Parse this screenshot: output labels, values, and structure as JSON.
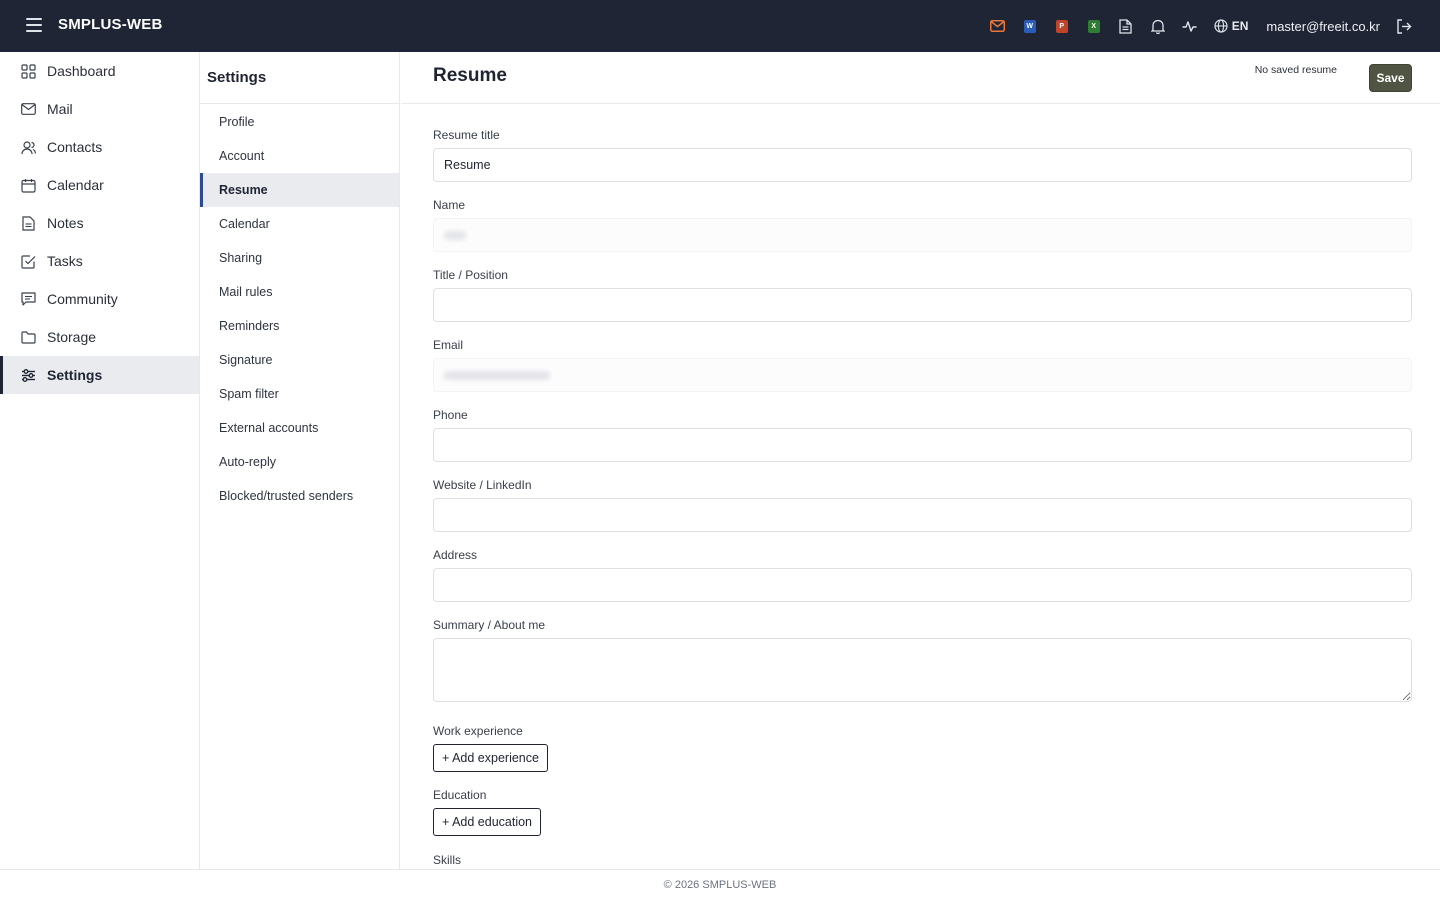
{
  "app": {
    "title": "SMPLUS-WEB"
  },
  "topbar": {
    "icons": [
      "mail-icon",
      "word-icon",
      "powerpoint-icon",
      "excel-icon",
      "document-icon",
      "bell-icon",
      "activity-icon",
      "globe-icon",
      "logout-icon"
    ],
    "word_badge": "W",
    "ppt_badge": "P",
    "excel_badge": "X",
    "language": "EN",
    "user_email": "master@freeit.co.kr",
    "colors": {
      "mail": "#e8773a",
      "word": "#2b5cb8",
      "powerpoint": "#c0442b",
      "excel": "#2e7d32",
      "bar": "#1f2535"
    }
  },
  "sidebar": {
    "items": [
      {
        "label": "Dashboard",
        "icon": "dashboard-icon"
      },
      {
        "label": "Mail",
        "icon": "mail-icon"
      },
      {
        "label": "Contacts",
        "icon": "contacts-icon"
      },
      {
        "label": "Calendar",
        "icon": "calendar-icon"
      },
      {
        "label": "Notes",
        "icon": "notes-icon"
      },
      {
        "label": "Tasks",
        "icon": "tasks-icon"
      },
      {
        "label": "Community",
        "icon": "community-icon"
      },
      {
        "label": "Storage",
        "icon": "folder-icon"
      },
      {
        "label": "Settings",
        "icon": "settings-icon",
        "active": true
      }
    ]
  },
  "settings": {
    "title": "Settings",
    "items": [
      {
        "label": "Profile"
      },
      {
        "label": "Account"
      },
      {
        "label": "Resume",
        "active": true
      },
      {
        "label": "Calendar"
      },
      {
        "label": "Sharing"
      },
      {
        "label": "Mail rules"
      },
      {
        "label": "Reminders"
      },
      {
        "label": "Signature"
      },
      {
        "label": "Spam filter"
      },
      {
        "label": "External accounts"
      },
      {
        "label": "Auto-reply"
      },
      {
        "label": "Blocked/trusted senders"
      }
    ]
  },
  "main": {
    "title": "Resume",
    "status": "No saved resume",
    "save_label": "Save",
    "fields": {
      "resume_title": {
        "label": "Resume title",
        "value": "Resume"
      },
      "name": {
        "label": "Name",
        "value": ""
      },
      "position": {
        "label": "Title / Position",
        "value": ""
      },
      "email": {
        "label": "Email",
        "value": ""
      },
      "phone": {
        "label": "Phone",
        "value": ""
      },
      "website": {
        "label": "Website / LinkedIn",
        "value": ""
      },
      "address": {
        "label": "Address",
        "value": ""
      },
      "summary": {
        "label": "Summary / About me",
        "value": ""
      }
    },
    "work": {
      "label": "Work experience",
      "button": "+ Add experience"
    },
    "education": {
      "label": "Education",
      "button": "+ Add education"
    },
    "skills": {
      "label": "Skills"
    }
  },
  "footer": {
    "text": "© 2026 SMPLUS-WEB"
  }
}
